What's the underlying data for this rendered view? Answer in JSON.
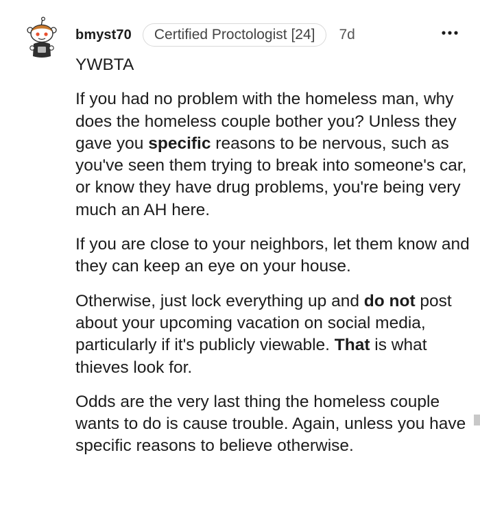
{
  "comment": {
    "username": "bmyst70",
    "flair": "Certified Proctologist [24]",
    "timestamp": "7d",
    "more_label": "More options",
    "paragraphs": [
      {
        "segments": [
          {
            "text": "YWBTA",
            "bold": false
          }
        ]
      },
      {
        "segments": [
          {
            "text": "If you had no problem with the homeless man, why does the homeless couple bother you? Unless they gave you ",
            "bold": false
          },
          {
            "text": "specific",
            "bold": true
          },
          {
            "text": " reasons to be nervous, such as you've seen them trying to break into someone's car, or know they have drug problems, you're being very much an AH here.",
            "bold": false
          }
        ]
      },
      {
        "segments": [
          {
            "text": "If you are close to your neighbors, let them know and they can keep an eye on your house.",
            "bold": false
          }
        ]
      },
      {
        "segments": [
          {
            "text": "Otherwise, just lock everything up and ",
            "bold": false
          },
          {
            "text": "do not",
            "bold": true
          },
          {
            "text": " post about your upcoming vacation on social media, particularly if it's publicly viewable. ",
            "bold": false
          },
          {
            "text": "That",
            "bold": true
          },
          {
            "text": " is what thieves look for.",
            "bold": false
          }
        ]
      },
      {
        "segments": [
          {
            "text": "Odds are the very last thing the homeless couple wants to do is cause trouble. Again, unless you have specific reasons to believe otherwise.",
            "bold": false
          }
        ]
      }
    ]
  },
  "icons": {
    "avatar": "snoo-avatar-icon",
    "more": "three-dots-icon"
  },
  "colors": {
    "text": "#1c1c1c",
    "muted": "#555555",
    "flair_border": "#d9d9d9"
  }
}
